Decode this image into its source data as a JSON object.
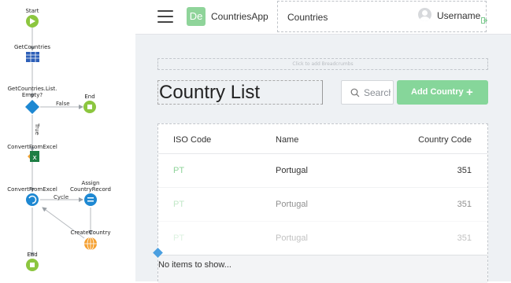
{
  "flow": {
    "nodes": {
      "start": "Start",
      "get_countries": "GetCountries",
      "if_empty": "GetCountries.List.\nEmpty?",
      "end_top": "End",
      "convert_from_excel": "ConvertFromExcel",
      "foreach": "ConvertFromExcel",
      "assign": "Assign\nCountryRecord",
      "create_country": "CreateCountry",
      "end_bottom": "End"
    },
    "connectors": {
      "false": "False",
      "true": "True",
      "cycle": "Cycle"
    }
  },
  "header": {
    "logo_text": "De",
    "app_name": "CountriesApp",
    "menu_item": "Countries",
    "username": "Username"
  },
  "breadcrumbs_placeholder": "Click to add Breadcrumbs",
  "page": {
    "title": "Country List",
    "search_placeholder": "Search",
    "add_button_label": "Add Country",
    "add_button_icon": "+"
  },
  "table": {
    "columns": [
      "ISO Code",
      "Name",
      "Country Code"
    ],
    "rows": [
      {
        "iso": "PT",
        "name": "Portugal",
        "code": "351"
      },
      {
        "iso": "PT",
        "name": "Portugal",
        "code": "351"
      },
      {
        "iso": "PT",
        "name": "Portugal",
        "code": "351"
      }
    ],
    "empty_message": "No items to show..."
  },
  "colors": {
    "accent_green": "#86d69a",
    "flow_green": "#8cc63f",
    "flow_blue": "#1e88d2",
    "flow_orange": "#f5a132"
  }
}
